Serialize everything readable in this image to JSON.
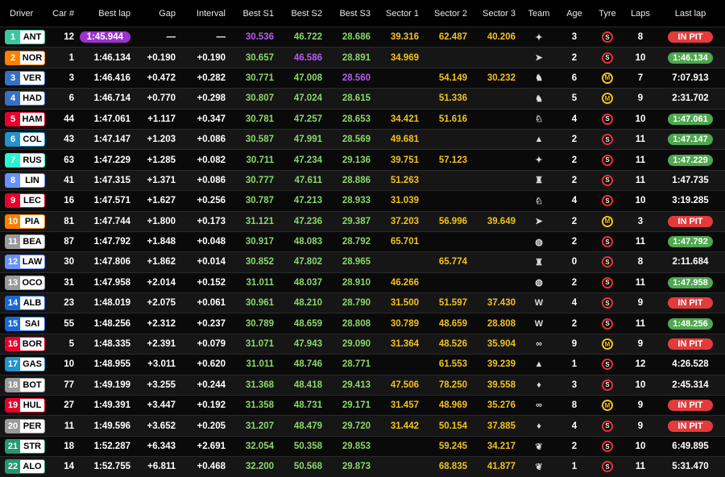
{
  "columns": [
    "Driver",
    "Car #",
    "Best lap",
    "Gap",
    "Interval",
    "Best S1",
    "Best S2",
    "Best S3",
    "Sector 1",
    "Sector 2",
    "Sector 3",
    "Team",
    "Age",
    "Tyre",
    "Laps",
    "Last lap"
  ],
  "drivers": [
    {
      "pos": "1",
      "code": "ANT",
      "color": "#3cc7a0",
      "car": "12",
      "best_lap": "1:45.944",
      "best_lap_purple": true,
      "gap": "—",
      "interval": "—",
      "s1": "30.536",
      "s1c": "purple",
      "s2": "46.722",
      "s2c": "green",
      "s3": "28.686",
      "s3c": "green",
      "sec1": "39.316",
      "sec1c": "yellow",
      "sec2": "62.487",
      "sec2c": "yellow",
      "sec3": "40.206",
      "sec3c": "yellow",
      "team_icon": "mercedes-icon",
      "team": "✦",
      "age": "3",
      "tyre": "S",
      "laps": "8",
      "last_lap": "IN PIT",
      "last_style": "red"
    },
    {
      "pos": "2",
      "code": "NOR",
      "color": "#ff8000",
      "car": "1",
      "best_lap": "1:46.134",
      "gap": "+0.190",
      "interval": "+0.190",
      "s1": "30.657",
      "s1c": "green",
      "s2": "46.586",
      "s2c": "purple",
      "s3": "28.891",
      "s3c": "green",
      "sec1": "34.969",
      "sec1c": "yellow",
      "sec2": "",
      "sec2c": "yellow",
      "sec3": "",
      "sec3c": "yellow",
      "team_icon": "mclaren-icon",
      "team": "➤",
      "age": "2",
      "tyre": "S",
      "laps": "10",
      "last_lap": "1:46.134",
      "last_style": "green"
    },
    {
      "pos": "3",
      "code": "VER",
      "color": "#3671c6",
      "car": "3",
      "best_lap": "1:46.416",
      "gap": "+0.472",
      "interval": "+0.282",
      "s1": "30.771",
      "s1c": "green",
      "s2": "47.008",
      "s2c": "green",
      "s3": "28.560",
      "s3c": "purple",
      "sec1": "",
      "sec1c": "yellow",
      "sec2": "54.149",
      "sec2c": "yellow",
      "sec3": "30.232",
      "sec3c": "yellow",
      "team_icon": "red-bull-icon",
      "team": "♞",
      "age": "6",
      "tyre": "M",
      "laps": "7",
      "last_lap": "7:07.913",
      "last_style": "plain"
    },
    {
      "pos": "4",
      "code": "HAD",
      "color": "#3671c6",
      "car": "6",
      "best_lap": "1:46.714",
      "gap": "+0.770",
      "interval": "+0.298",
      "s1": "30.807",
      "s1c": "green",
      "s2": "47.024",
      "s2c": "green",
      "s3": "28.615",
      "s3c": "green",
      "sec1": "",
      "sec1c": "yellow",
      "sec2": "51.336",
      "sec2c": "yellow",
      "sec3": "",
      "sec3c": "yellow",
      "team_icon": "red-bull-icon",
      "team": "♞",
      "age": "5",
      "tyre": "M",
      "laps": "9",
      "last_lap": "2:31.702",
      "last_style": "plain"
    },
    {
      "pos": "5",
      "code": "HAM",
      "color": "#e8002d",
      "car": "44",
      "best_lap": "1:47.061",
      "gap": "+1.117",
      "interval": "+0.347",
      "s1": "30.781",
      "s1c": "green",
      "s2": "47.257",
      "s2c": "green",
      "s3": "28.653",
      "s3c": "green",
      "sec1": "34.421",
      "sec1c": "yellow",
      "sec2": "51.616",
      "sec2c": "yellow",
      "sec3": "",
      "sec3c": "yellow",
      "team_icon": "ferrari-icon",
      "team": "♘",
      "age": "4",
      "tyre": "S",
      "laps": "10",
      "last_lap": "1:47.061",
      "last_style": "green"
    },
    {
      "pos": "6",
      "code": "COL",
      "color": "#2293d1",
      "car": "43",
      "best_lap": "1:47.147",
      "gap": "+1.203",
      "interval": "+0.086",
      "s1": "30.587",
      "s1c": "green",
      "s2": "47.991",
      "s2c": "green",
      "s3": "28.569",
      "s3c": "green",
      "sec1": "49.681",
      "sec1c": "yellow",
      "sec2": "",
      "sec2c": "yellow",
      "sec3": "",
      "sec3c": "yellow",
      "team_icon": "alpine-icon",
      "team": "▲",
      "age": "2",
      "tyre": "S",
      "laps": "11",
      "last_lap": "1:47.147",
      "last_style": "green"
    },
    {
      "pos": "7",
      "code": "RUS",
      "color": "#27f4d2",
      "car": "63",
      "best_lap": "1:47.229",
      "gap": "+1.285",
      "interval": "+0.082",
      "s1": "30.711",
      "s1c": "green",
      "s2": "47.234",
      "s2c": "green",
      "s3": "29.136",
      "s3c": "green",
      "sec1": "39.751",
      "sec1c": "yellow",
      "sec2": "57.123",
      "sec2c": "yellow",
      "sec3": "",
      "sec3c": "yellow",
      "team_icon": "mercedes-icon",
      "team": "✦",
      "age": "2",
      "tyre": "S",
      "laps": "11",
      "last_lap": "1:47.229",
      "last_style": "green"
    },
    {
      "pos": "8",
      "code": "LIN",
      "color": "#6692ff",
      "car": "41",
      "best_lap": "1:47.315",
      "gap": "+1.371",
      "interval": "+0.086",
      "s1": "30.777",
      "s1c": "green",
      "s2": "47.611",
      "s2c": "green",
      "s3": "28.886",
      "s3c": "green",
      "sec1": "51.263",
      "sec1c": "yellow",
      "sec2": "",
      "sec2c": "yellow",
      "sec3": "",
      "sec3c": "yellow",
      "team_icon": "racing-bulls-icon",
      "team": "♜",
      "age": "2",
      "tyre": "S",
      "laps": "11",
      "last_lap": "1:47.735",
      "last_style": "plain"
    },
    {
      "pos": "9",
      "code": "LEC",
      "color": "#e8002d",
      "car": "16",
      "best_lap": "1:47.571",
      "gap": "+1.627",
      "interval": "+0.256",
      "s1": "30.787",
      "s1c": "green",
      "s2": "47.213",
      "s2c": "green",
      "s3": "28.933",
      "s3c": "green",
      "sec1": "31.039",
      "sec1c": "yellow",
      "sec2": "",
      "sec2c": "yellow",
      "sec3": "",
      "sec3c": "yellow",
      "team_icon": "ferrari-icon",
      "team": "♘",
      "age": "4",
      "tyre": "S",
      "laps": "10",
      "last_lap": "3:19.285",
      "last_style": "plain"
    },
    {
      "pos": "10",
      "code": "PIA",
      "color": "#ff8000",
      "car": "81",
      "best_lap": "1:47.744",
      "gap": "+1.800",
      "interval": "+0.173",
      "s1": "31.121",
      "s1c": "green",
      "s2": "47.236",
      "s2c": "green",
      "s3": "29.387",
      "s3c": "green",
      "sec1": "37.203",
      "sec1c": "yellow",
      "sec2": "56.996",
      "sec2c": "yellow",
      "sec3": "39.649",
      "sec3c": "yellow",
      "team_icon": "mclaren-icon",
      "team": "➤",
      "age": "2",
      "tyre": "M",
      "laps": "3",
      "last_lap": "IN PIT",
      "last_style": "red"
    },
    {
      "pos": "11",
      "code": "BEA",
      "color": "#9a9a9a",
      "car": "87",
      "best_lap": "1:47.792",
      "gap": "+1.848",
      "interval": "+0.048",
      "s1": "30.917",
      "s1c": "green",
      "s2": "48.083",
      "s2c": "green",
      "s3": "28.792",
      "s3c": "green",
      "sec1": "65.701",
      "sec1c": "yellow",
      "sec2": "",
      "sec2c": "yellow",
      "sec3": "",
      "sec3c": "yellow",
      "team_icon": "haas-icon",
      "team": "◍",
      "age": "2",
      "tyre": "S",
      "laps": "11",
      "last_lap": "1:47.792",
      "last_style": "green"
    },
    {
      "pos": "12",
      "code": "LAW",
      "color": "#6692ff",
      "car": "30",
      "best_lap": "1:47.806",
      "gap": "+1.862",
      "interval": "+0.014",
      "s1": "30.852",
      "s1c": "green",
      "s2": "47.802",
      "s2c": "green",
      "s3": "28.965",
      "s3c": "green",
      "sec1": "",
      "sec1c": "yellow",
      "sec2": "65.774",
      "sec2c": "yellow",
      "sec3": "",
      "sec3c": "yellow",
      "team_icon": "racing-bulls-icon",
      "team": "♜",
      "age": "0",
      "tyre": "S",
      "laps": "8",
      "last_lap": "2:11.684",
      "last_style": "plain"
    },
    {
      "pos": "13",
      "code": "OCO",
      "color": "#9a9a9a",
      "car": "31",
      "best_lap": "1:47.958",
      "gap": "+2.014",
      "interval": "+0.152",
      "s1": "31.011",
      "s1c": "green",
      "s2": "48.037",
      "s2c": "green",
      "s3": "28.910",
      "s3c": "green",
      "sec1": "46.266",
      "sec1c": "yellow",
      "sec2": "",
      "sec2c": "yellow",
      "sec3": "",
      "sec3c": "yellow",
      "team_icon": "haas-icon",
      "team": "◍",
      "age": "2",
      "tyre": "S",
      "laps": "11",
      "last_lap": "1:47.958",
      "last_style": "green"
    },
    {
      "pos": "14",
      "code": "ALB",
      "color": "#1868db",
      "car": "23",
      "best_lap": "1:48.019",
      "gap": "+2.075",
      "interval": "+0.061",
      "s1": "30.961",
      "s1c": "green",
      "s2": "48.210",
      "s2c": "green",
      "s3": "28.790",
      "s3c": "green",
      "sec1": "31.500",
      "sec1c": "yellow",
      "sec2": "51.597",
      "sec2c": "yellow",
      "sec3": "37.430",
      "sec3c": "yellow",
      "team_icon": "williams-icon",
      "team": "W",
      "age": "4",
      "tyre": "S",
      "laps": "9",
      "last_lap": "IN PIT",
      "last_style": "red"
    },
    {
      "pos": "15",
      "code": "SAI",
      "color": "#1868db",
      "car": "55",
      "best_lap": "1:48.256",
      "gap": "+2.312",
      "interval": "+0.237",
      "s1": "30.789",
      "s1c": "green",
      "s2": "48.659",
      "s2c": "green",
      "s3": "28.808",
      "s3c": "green",
      "sec1": "30.789",
      "sec1c": "yellow",
      "sec2": "48.659",
      "sec2c": "yellow",
      "sec3": "28.808",
      "sec3c": "yellow",
      "team_icon": "williams-icon",
      "team": "W",
      "age": "2",
      "tyre": "S",
      "laps": "11",
      "last_lap": "1:48.256",
      "last_style": "green"
    },
    {
      "pos": "16",
      "code": "BOR",
      "color": "#e8002d",
      "car": "5",
      "best_lap": "1:48.335",
      "gap": "+2.391",
      "interval": "+0.079",
      "s1": "31.071",
      "s1c": "green",
      "s2": "47.943",
      "s2c": "green",
      "s3": "29.090",
      "s3c": "green",
      "sec1": "31.364",
      "sec1c": "yellow",
      "sec2": "48.526",
      "sec2c": "yellow",
      "sec3": "35.904",
      "sec3c": "yellow",
      "team_icon": "audi-icon",
      "team": "∞",
      "age": "9",
      "tyre": "M",
      "laps": "9",
      "last_lap": "IN PIT",
      "last_style": "red"
    },
    {
      "pos": "17",
      "code": "GAS",
      "color": "#2293d1",
      "car": "10",
      "best_lap": "1:48.955",
      "gap": "+3.011",
      "interval": "+0.620",
      "s1": "31.011",
      "s1c": "green",
      "s2": "48.746",
      "s2c": "green",
      "s3": "28.771",
      "s3c": "green",
      "sec1": "",
      "sec1c": "yellow",
      "sec2": "61.553",
      "sec2c": "yellow",
      "sec3": "39.239",
      "sec3c": "yellow",
      "team_icon": "alpine-icon",
      "team": "▲",
      "age": "1",
      "tyre": "S",
      "laps": "12",
      "last_lap": "4:26.528",
      "last_style": "plain"
    },
    {
      "pos": "18",
      "code": "BOT",
      "color": "#9a9a9a",
      "car": "77",
      "best_lap": "1:49.199",
      "gap": "+3.255",
      "interval": "+0.244",
      "s1": "31.368",
      "s1c": "green",
      "s2": "48.418",
      "s2c": "green",
      "s3": "29.413",
      "s3c": "green",
      "sec1": "47.506",
      "sec1c": "yellow",
      "sec2": "78.250",
      "sec2c": "yellow",
      "sec3": "39.558",
      "sec3c": "yellow",
      "team_icon": "cadillac-icon",
      "team": "♦",
      "age": "3",
      "tyre": "S",
      "laps": "10",
      "last_lap": "2:45.314",
      "last_style": "plain"
    },
    {
      "pos": "19",
      "code": "HUL",
      "color": "#e8002d",
      "car": "27",
      "best_lap": "1:49.391",
      "gap": "+3.447",
      "interval": "+0.192",
      "s1": "31.358",
      "s1c": "green",
      "s2": "48.731",
      "s2c": "green",
      "s3": "29.171",
      "s3c": "green",
      "sec1": "31.457",
      "sec1c": "yellow",
      "sec2": "48.969",
      "sec2c": "yellow",
      "sec3": "35.276",
      "sec3c": "yellow",
      "team_icon": "audi-icon",
      "team": "∞",
      "age": "8",
      "tyre": "M",
      "laps": "9",
      "last_lap": "IN PIT",
      "last_style": "red"
    },
    {
      "pos": "20",
      "code": "PER",
      "color": "#9a9a9a",
      "car": "11",
      "best_lap": "1:49.596",
      "gap": "+3.652",
      "interval": "+0.205",
      "s1": "31.207",
      "s1c": "green",
      "s2": "48.479",
      "s2c": "green",
      "s3": "29.720",
      "s3c": "green",
      "sec1": "31.442",
      "sec1c": "yellow",
      "sec2": "50.154",
      "sec2c": "yellow",
      "sec3": "37.885",
      "sec3c": "yellow",
      "team_icon": "cadillac-icon",
      "team": "♦",
      "age": "4",
      "tyre": "S",
      "laps": "9",
      "last_lap": "IN PIT",
      "last_style": "red"
    },
    {
      "pos": "21",
      "code": "STR",
      "color": "#229971",
      "car": "18",
      "best_lap": "1:52.287",
      "gap": "+6.343",
      "interval": "+2.691",
      "s1": "32.054",
      "s1c": "green",
      "s2": "50.358",
      "s2c": "green",
      "s3": "29.853",
      "s3c": "green",
      "sec1": "",
      "sec1c": "yellow",
      "sec2": "59.245",
      "sec2c": "yellow",
      "sec3": "34.217",
      "sec3c": "yellow",
      "team_icon": "aston-martin-icon",
      "team": "❦",
      "age": "2",
      "tyre": "S",
      "laps": "10",
      "last_lap": "6:49.895",
      "last_style": "plain"
    },
    {
      "pos": "22",
      "code": "ALO",
      "color": "#229971",
      "car": "14",
      "best_lap": "1:52.755",
      "gap": "+6.811",
      "interval": "+0.468",
      "s1": "32.200",
      "s1c": "green",
      "s2": "50.568",
      "s2c": "green",
      "s3": "29.873",
      "s3c": "green",
      "sec1": "",
      "sec1c": "yellow",
      "sec2": "68.835",
      "sec2c": "yellow",
      "sec3": "41.877",
      "sec3c": "yellow",
      "team_icon": "aston-martin-icon",
      "team": "❦",
      "age": "1",
      "tyre": "S",
      "laps": "11",
      "last_lap": "5:31.470",
      "last_style": "plain"
    }
  ]
}
